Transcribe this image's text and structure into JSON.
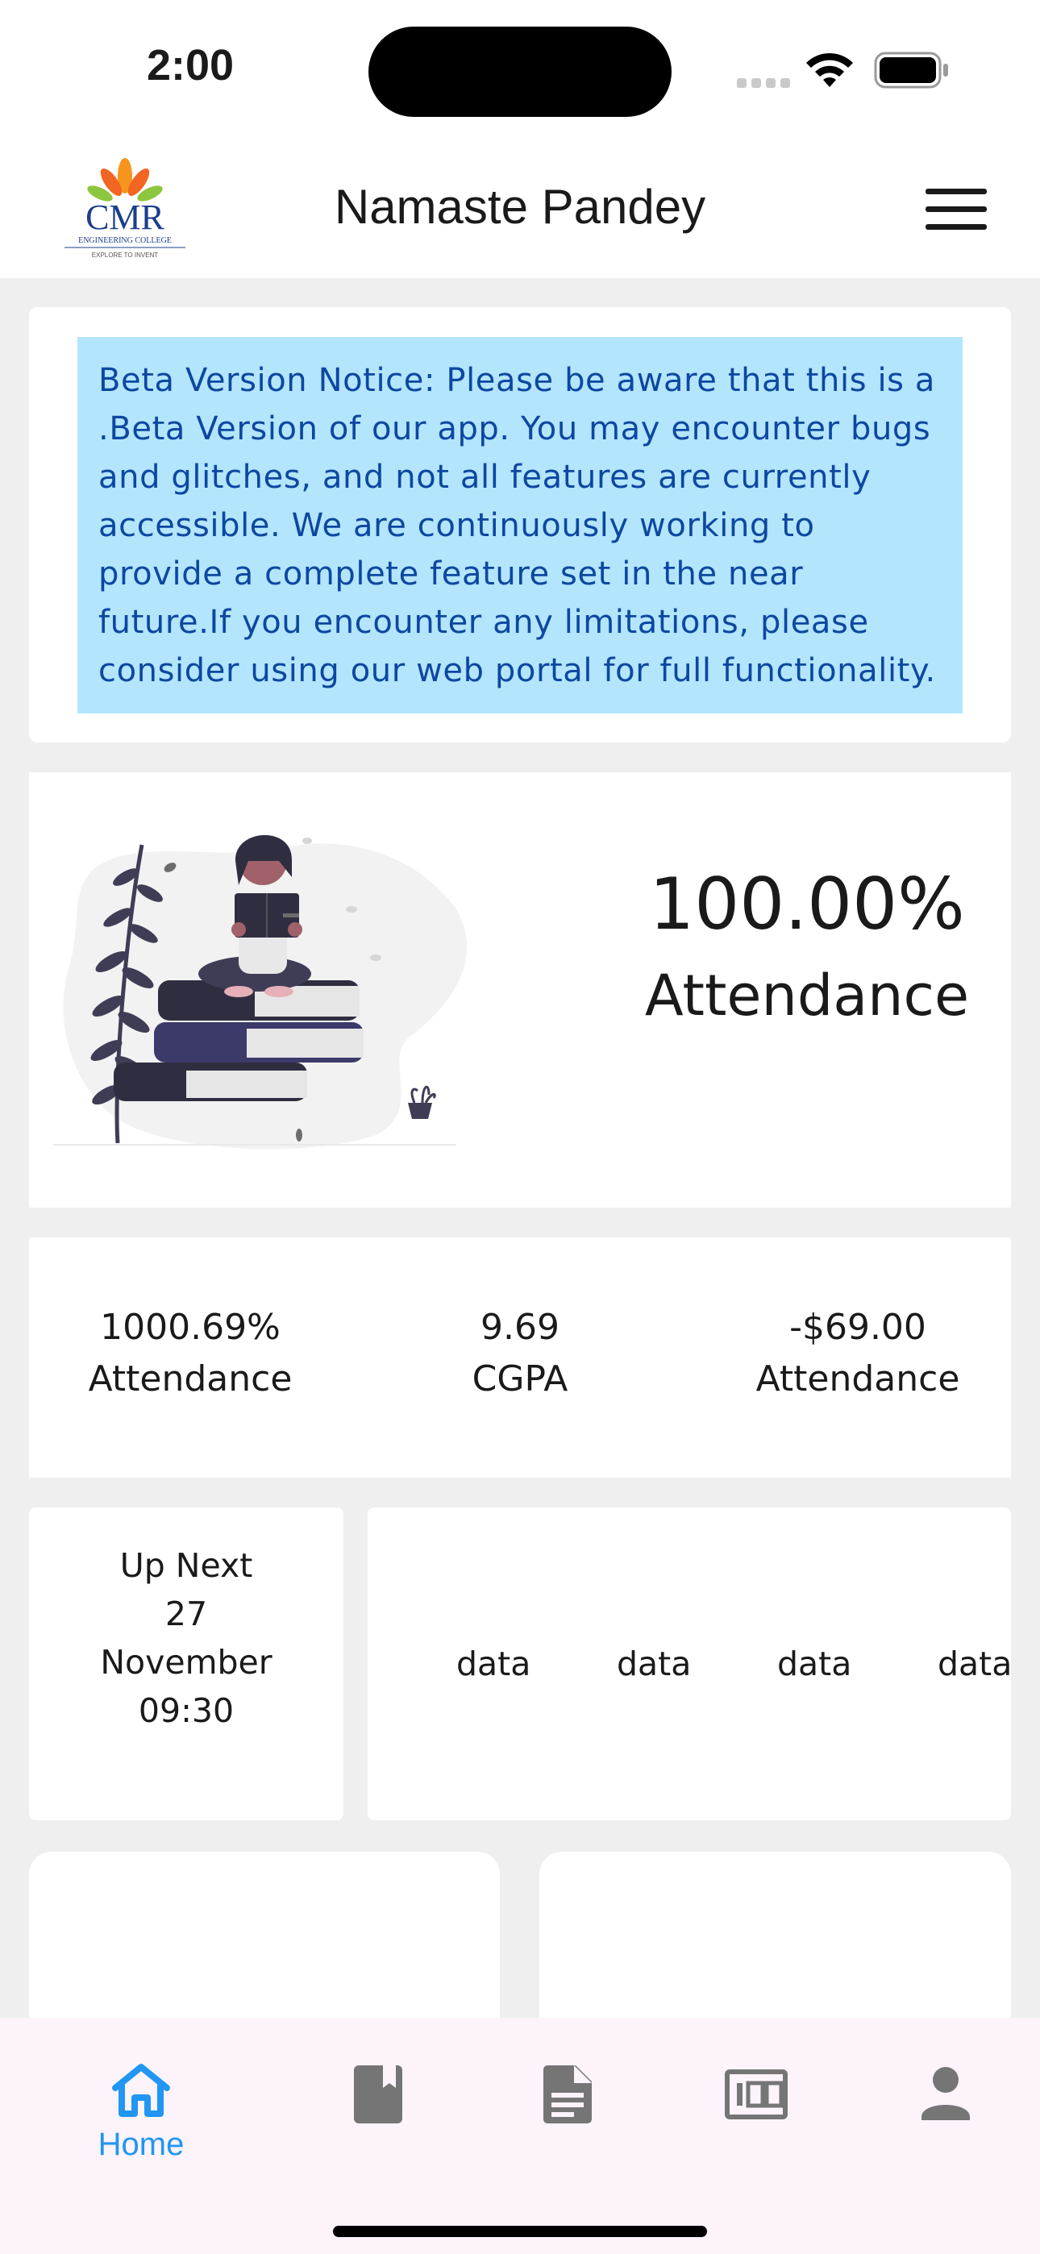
{
  "status_bar": {
    "time": "2:00"
  },
  "header": {
    "logo": {
      "name": "CMR",
      "subtitle": "ENGINEERING COLLEGE",
      "tagline": "EXPLORE TO INVENT"
    },
    "title": "Namaste Pandey",
    "menu_icon": "hamburger-menu-icon"
  },
  "notice": {
    "text": "Beta Version Notice: Please be aware that this is a .Beta Version of our app. You may encounter bugs and glitches, and not all features are currently accessible. We are continuously working to provide a complete feature set in the near future.If you encounter any limitations, please consider using our web portal for full functionality."
  },
  "attendance_card": {
    "percent": "100.00%",
    "label": "Attendance"
  },
  "stats": [
    {
      "value": "1000.69%",
      "label": "Attendance"
    },
    {
      "value": "9.69",
      "label": "CGPA"
    },
    {
      "value": "-$69.00",
      "label": "Attendance"
    }
  ],
  "up_next": {
    "title": "Up Next",
    "day": "27",
    "month": "November",
    "time": "09:30"
  },
  "data_cells": [
    "data",
    "data",
    "data",
    "data"
  ],
  "bottom_nav": {
    "items": [
      {
        "icon": "home-icon",
        "label": "Home",
        "active": true
      },
      {
        "icon": "book-icon",
        "label": ""
      },
      {
        "icon": "document-icon",
        "label": ""
      },
      {
        "icon": "scores-icon",
        "label": ""
      },
      {
        "icon": "person-icon",
        "label": ""
      }
    ]
  },
  "colors": {
    "accent": "#2196f3",
    "notice_bg": "#b3e5fc",
    "notice_text": "#0d47a1",
    "page_bg": "#efefef",
    "nav_bg": "#fcf3fb",
    "inactive_icon": "#757575"
  }
}
